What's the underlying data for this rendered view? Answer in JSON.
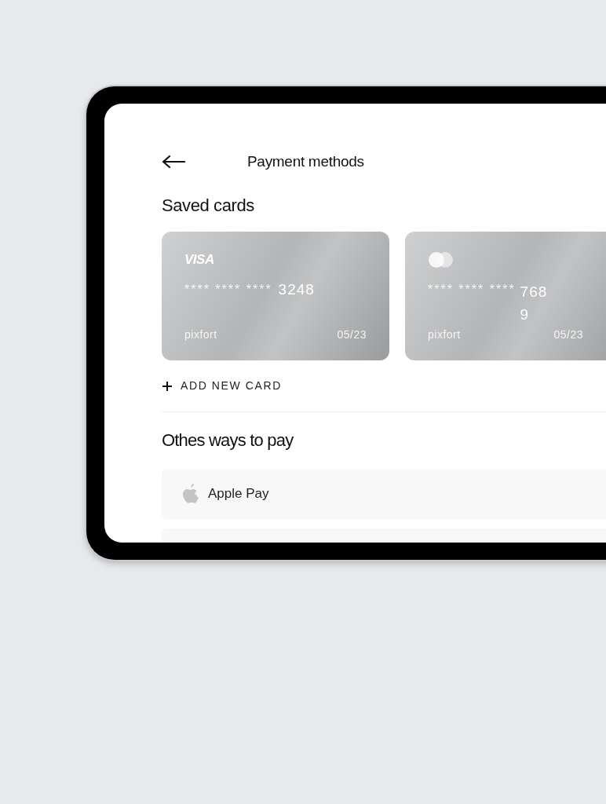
{
  "header": {
    "title": "Payment methods"
  },
  "saved_cards": {
    "heading": "Saved cards",
    "cards": [
      {
        "kind": "visa",
        "brand": "VISA",
        "mask": "**** **** ****",
        "last4": "3248",
        "holder": "pixfort",
        "expiry": "05/23"
      },
      {
        "kind": "mastercard",
        "mask": "**** **** ****",
        "last4": "7689",
        "holder": "pixfort",
        "expiry": "05/23"
      }
    ]
  },
  "add_card": {
    "label": "ADD NEW CARD"
  },
  "other_ways": {
    "heading": "Othes ways to pay",
    "methods": [
      {
        "kind": "apple",
        "label": "Apple Pay"
      },
      {
        "kind": "blank"
      }
    ]
  }
}
